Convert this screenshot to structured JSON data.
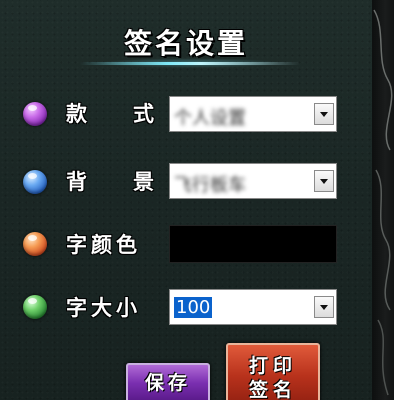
{
  "title": "签名设置",
  "rows": [
    {
      "label_a": "款",
      "label_b": "式",
      "value": "个人设置",
      "color": "#a23ec7"
    },
    {
      "label_a": "背",
      "label_b": "景",
      "value": "飞行板车",
      "color": "#3a7fe0"
    },
    {
      "label_a": "字颜色",
      "color": "#e8682a",
      "swatch": "#000000"
    },
    {
      "label_a": "字大小",
      "value": "100",
      "color": "#3aa84a"
    }
  ],
  "buttons": {
    "save": "保存",
    "print_1": "打印",
    "print_2": "签名"
  }
}
